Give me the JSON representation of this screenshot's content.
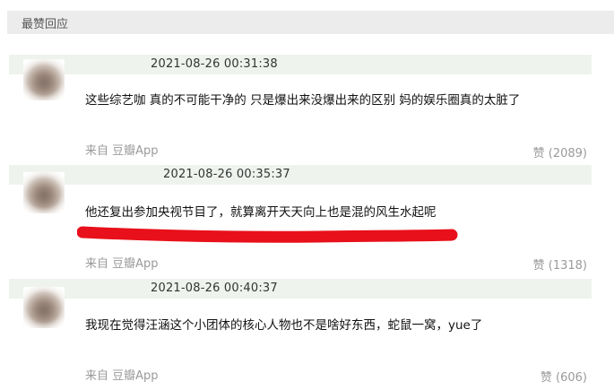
{
  "section": {
    "title": "最赞回应"
  },
  "comments": [
    {
      "timestamp": "2021-08-26 00:31:38",
      "text": "这些综艺咖 真的不可能干净的 只是爆出来没爆出来的区别 妈的娱乐圈真的太脏了",
      "source": "来自 豆瓣App",
      "likes": "赞 (2089)"
    },
    {
      "timestamp": "2021-08-26 00:35:37",
      "text": "他还复出参加央视节目了，就算离开天天向上也是混的风生水起呢",
      "source": "来自 豆瓣App",
      "likes": "赞 (1318)"
    },
    {
      "timestamp": "2021-08-26 00:40:37",
      "text": "我现在觉得汪涵这个小团体的核心人物也不是啥好东西，蛇鼠一窝，yue了",
      "source": "来自 豆瓣App",
      "likes": "赞 (606)"
    }
  ],
  "colors": {
    "header_bg": "#ececec",
    "meta_bar_bg": "#eef3ee",
    "muted_text": "#9a9a9a",
    "highlight_mark": "#e8101a"
  }
}
